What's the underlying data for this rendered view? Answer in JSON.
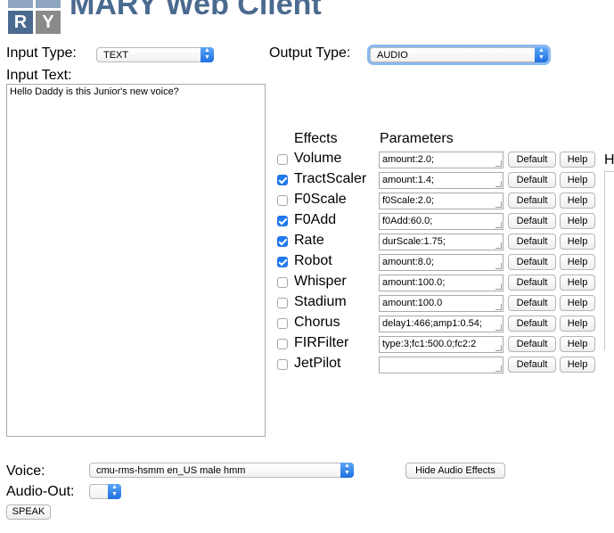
{
  "logo": {
    "letters": [
      "R",
      "Y"
    ]
  },
  "app_title": "MARY Web Client",
  "input_type": {
    "label": "Input Type:",
    "value": "TEXT"
  },
  "output_type": {
    "label": "Output Type:",
    "value": "AUDIO"
  },
  "input_text": {
    "label": "Input Text:",
    "value": "Hello Daddy is this Junior's new voice?"
  },
  "effects_header": "Effects",
  "parameters_header": "Parameters",
  "help_partial_label": "H",
  "effects": [
    {
      "name": "Volume",
      "checked": false,
      "param": "amount:2.0;",
      "default_label": "Default",
      "help_label": "Help"
    },
    {
      "name": "TractScaler",
      "checked": true,
      "param": "amount:1.4;",
      "default_label": "Default",
      "help_label": "Help"
    },
    {
      "name": "F0Scale",
      "checked": false,
      "param": "f0Scale:2.0;",
      "default_label": "Default",
      "help_label": "Help"
    },
    {
      "name": "F0Add",
      "checked": true,
      "param": "f0Add:60.0;",
      "default_label": "Default",
      "help_label": "Help"
    },
    {
      "name": "Rate",
      "checked": true,
      "param": "durScale:1.75;",
      "default_label": "Default",
      "help_label": "Help"
    },
    {
      "name": "Robot",
      "checked": true,
      "param": "amount:8.0;",
      "default_label": "Default",
      "help_label": "Help"
    },
    {
      "name": "Whisper",
      "checked": false,
      "param": "amount:100.0;",
      "default_label": "Default",
      "help_label": "Help"
    },
    {
      "name": "Stadium",
      "checked": false,
      "param": "amount:100.0",
      "default_label": "Default",
      "help_label": "Help"
    },
    {
      "name": "Chorus",
      "checked": false,
      "param": "delay1:466;amp1:0.54;",
      "default_label": "Default",
      "help_label": "Help"
    },
    {
      "name": "FIRFilter",
      "checked": false,
      "param": "type:3;fc1:500.0;fc2:2",
      "default_label": "Default",
      "help_label": "Help"
    },
    {
      "name": "JetPilot",
      "checked": false,
      "param": "",
      "default_label": "Default",
      "help_label": "Help"
    }
  ],
  "voice": {
    "label": "Voice:",
    "value": "cmu-rms-hsmm en_US male hmm"
  },
  "hide_effects_label": "Hide Audio Effects",
  "audio_out": {
    "label": "Audio-Out:",
    "value": ""
  },
  "speak_label": "SPEAK"
}
